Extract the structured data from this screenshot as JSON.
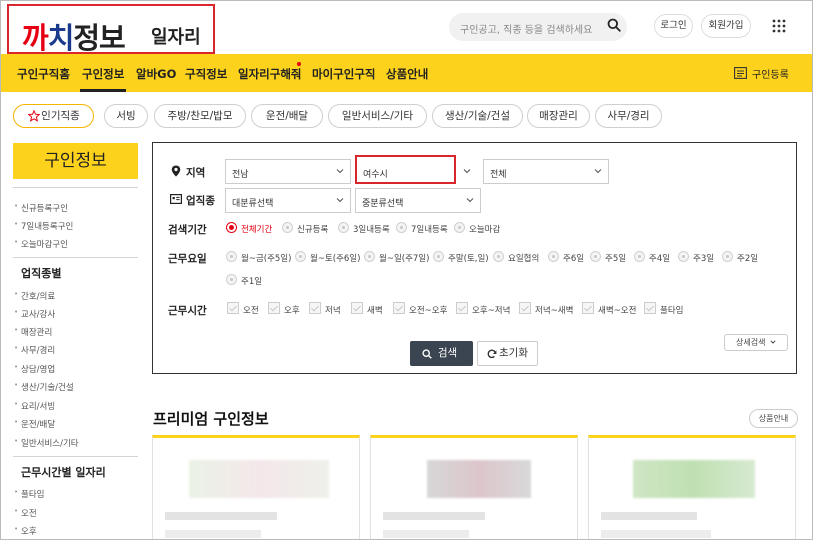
{
  "header": {
    "logo": {
      "part1": "까",
      "part2": "치",
      "part3": "정보",
      "sub": "일자리"
    },
    "search_placeholder": "구인공고, 직종 등을 검색하세요",
    "login": "로그인",
    "signup": "회원가입"
  },
  "nav": {
    "items": [
      "구인구직홈",
      "구인정보",
      "알바GO",
      "구직정보",
      "일자리구해줘",
      "마이구인구직",
      "상품안내"
    ],
    "active": "구인정보",
    "register": "구인등록"
  },
  "chips": {
    "hot": "인기직종",
    "items": [
      "서빙",
      "주방/찬모/밥모",
      "운전/배달",
      "일반서비스/기타",
      "생산/기술/건설",
      "매장관리",
      "사무/경리"
    ]
  },
  "sidebar": {
    "title": "구인정보",
    "top_links": [
      "신규등록구인",
      "7일내등록구인",
      "오늘마감구인"
    ],
    "section1": {
      "title": "업직종별",
      "links": [
        "간호/의료",
        "교사/강사",
        "매장관리",
        "사무/경리",
        "상담/영업",
        "생산/기술/건설",
        "요리/서빙",
        "운전/배달",
        "일반서비스/기타"
      ]
    },
    "section2": {
      "title": "근무시간별 일자리",
      "links": [
        "풀타임",
        "오전",
        "오후"
      ]
    }
  },
  "search": {
    "region_label": "지역",
    "region1": "전남",
    "region2": "여수시",
    "region3": "전체",
    "job_label": "업직종",
    "job1": "대분류선택",
    "job2": "중분류선택",
    "period_label": "검색기간",
    "period_options": [
      "전체기간",
      "신규등록",
      "3일내등록",
      "7일내등록",
      "오늘마감"
    ],
    "period_selected": "전체기간",
    "days_label": "근무요일",
    "days_options": [
      "월~금(주5일)",
      "월~토(주6일)",
      "월~일(주7일)",
      "주말(토,일)",
      "요일협의",
      "주6일",
      "주5일",
      "주4일",
      "주3일",
      "주2일",
      "주1일"
    ],
    "hours_label": "근무시간",
    "hours_options": [
      "오전",
      "오후",
      "저녁",
      "새벽",
      "오전~오후",
      "오후~저녁",
      "저녁~새벽",
      "새벽~오전",
      "풀타임"
    ],
    "search_btn": "검색",
    "reset_btn": "초기화",
    "detail_btn": "상세검색"
  },
  "premium": {
    "title": "프리미엄 구인정보",
    "guide_btn": "상품안내"
  },
  "colors": {
    "accent": "#fcd21c",
    "highlight": "#d9262c",
    "selected": "#e60012"
  }
}
